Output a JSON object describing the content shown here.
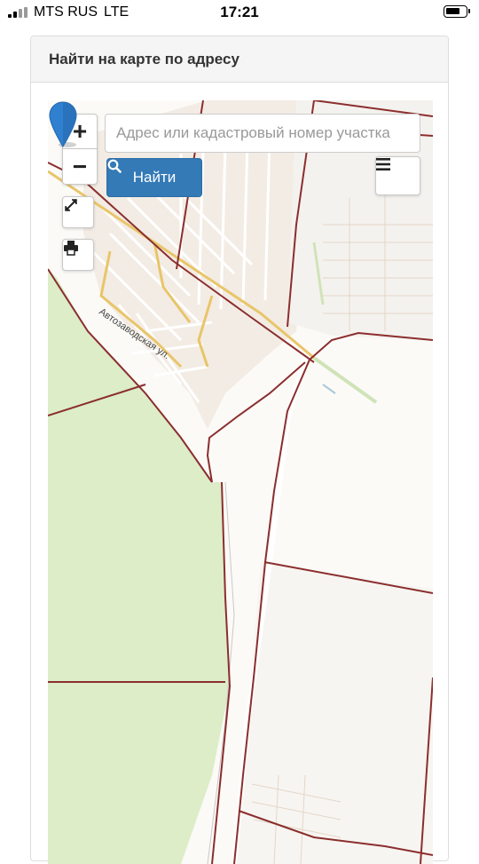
{
  "status_bar": {
    "carrier": "MTS RUS",
    "network": "LTE",
    "time": "17:21"
  },
  "panel": {
    "title": "Найти на карте по адресу"
  },
  "map": {
    "zoom_in_label": "+",
    "zoom_out_label": "−",
    "search": {
      "placeholder": "Адрес или кадастровый номер участка",
      "value": ""
    },
    "find_button_label": "Найти",
    "street_label": "Автозаводская ул.",
    "icons": [
      "search-icon",
      "menu-icon",
      "fullscreen-icon",
      "print-icon",
      "map-pin-icon"
    ],
    "colors": {
      "accent": "#337ab7",
      "forest": "#dcedc8",
      "parcel_border": "#8b2e2e",
      "road": "#e8c56a"
    }
  }
}
